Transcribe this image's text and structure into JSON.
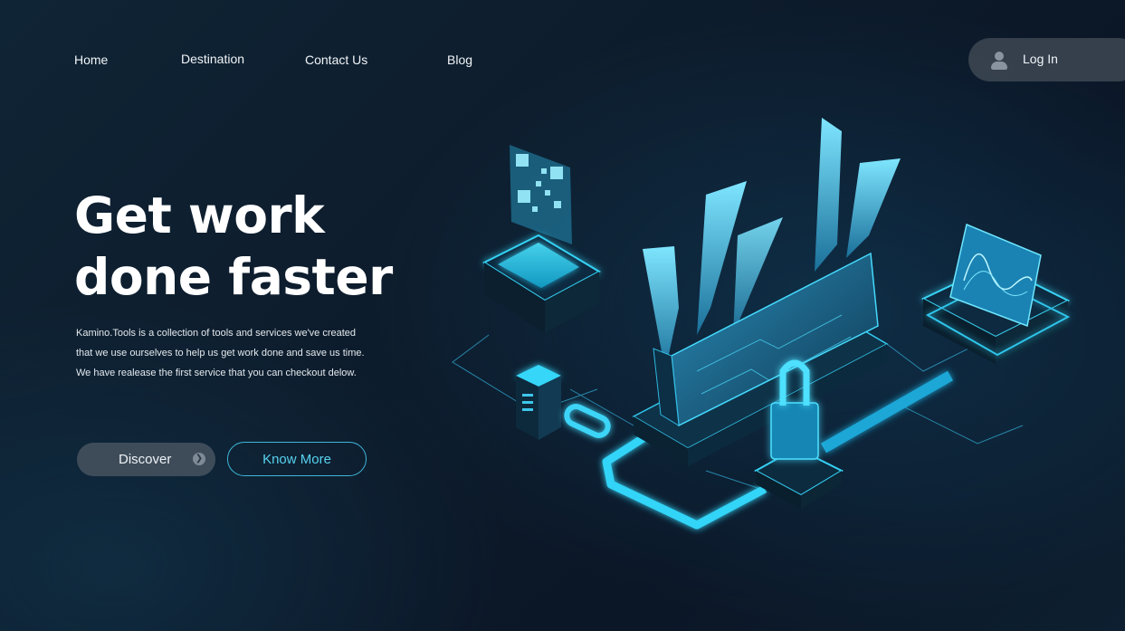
{
  "nav": {
    "items": [
      "Home",
      "Destination",
      "Contact Us",
      "Blog"
    ],
    "login_label": "Log In"
  },
  "hero": {
    "title_line1": "Get work",
    "title_line2": "done faster",
    "description_lines": [
      "Kamino.Tools is a collection of tools and services we've created",
      "that we use ourselves to help us get work done and save us time.",
      "We have realease the first service that you can checkout delow."
    ],
    "discover_label": "Discover",
    "know_more_label": "Know More"
  },
  "colors": {
    "accent": "#3fd3f5",
    "accent_dark": "#1a7fa8",
    "background": "#0d1c2c"
  },
  "icons": {
    "login": "user-icon",
    "discover": "chevron-right-icon"
  }
}
